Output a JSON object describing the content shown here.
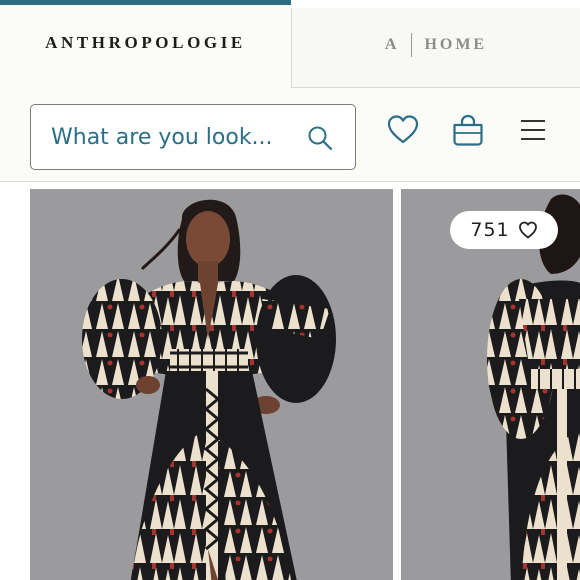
{
  "tabs": [
    {
      "label": "ANTHROPOLOGIE"
    },
    {
      "label_left": "A",
      "label_right": "HOME"
    }
  ],
  "search": {
    "placeholder": "What are you look..."
  },
  "header_icons": [
    "search-icon",
    "heart-icon",
    "shopping-bag-icon",
    "menu-icon"
  ],
  "products": [
    {
      "image": "product-photo-dress-1"
    },
    {
      "image": "product-photo-dress-2",
      "likes": "751",
      "like_icon": "heart-icon"
    }
  ],
  "colors": {
    "accent": "#2b6e86",
    "tab_active_bg": "#fbfbf8",
    "photo_bg": "#9b9a9c",
    "dress_black": "#1b1a1c",
    "dress_cream": "#ece1cc",
    "dress_red": "#a5342e"
  }
}
